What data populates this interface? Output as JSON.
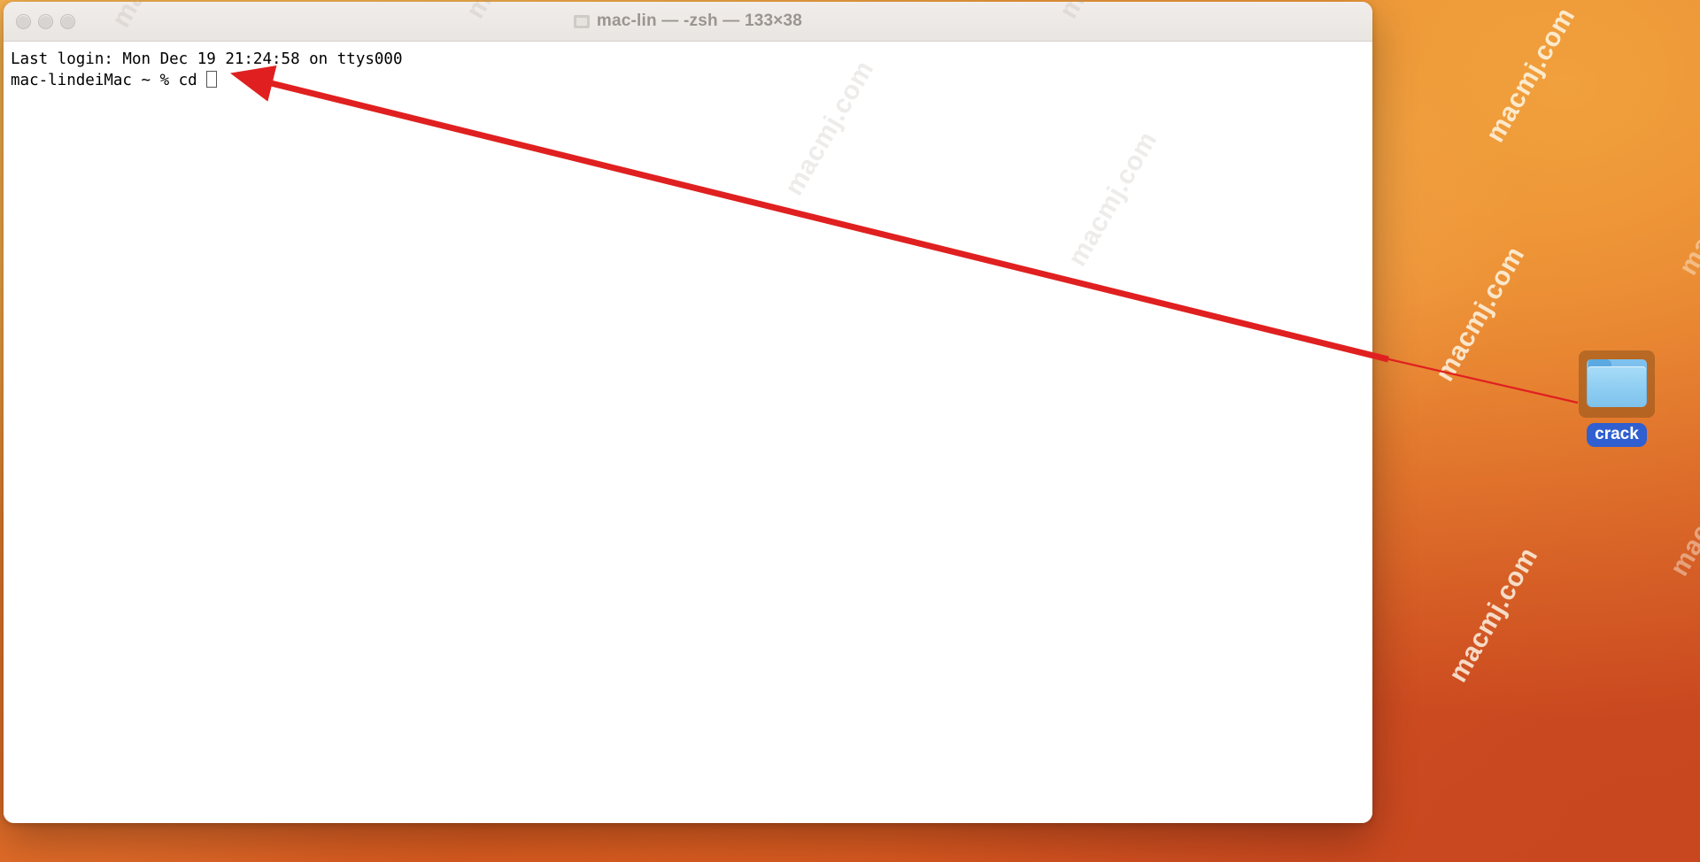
{
  "window": {
    "title": "mac-lin — -zsh — 133×38",
    "title_icon": "folder-icon",
    "traffic_lights": [
      {
        "name": "close-button",
        "label": "Close"
      },
      {
        "name": "minimize-button",
        "label": "Minimize"
      },
      {
        "name": "zoom-button",
        "label": "Zoom"
      }
    ]
  },
  "terminal": {
    "last_login": "Last login: Mon Dec 19 21:24:58 on ttys000",
    "prompt": "mac-lindeiMac ~ % cd ",
    "cursor": "block-cursor"
  },
  "desktop": {
    "icon": {
      "name": "crack",
      "label": "crack",
      "type": "folder",
      "selected": true
    },
    "watermark_text": "macmj.com"
  },
  "annotation": {
    "arrow_color": "#e02020",
    "arrow_from": "crack folder icon",
    "arrow_to": "terminal command line cursor"
  },
  "colors": {
    "accent_red": "#e02020",
    "folder_blue": "#8ecdf2",
    "selection_blue": "#2f5fd0",
    "titlebar": "#ece8e4"
  }
}
